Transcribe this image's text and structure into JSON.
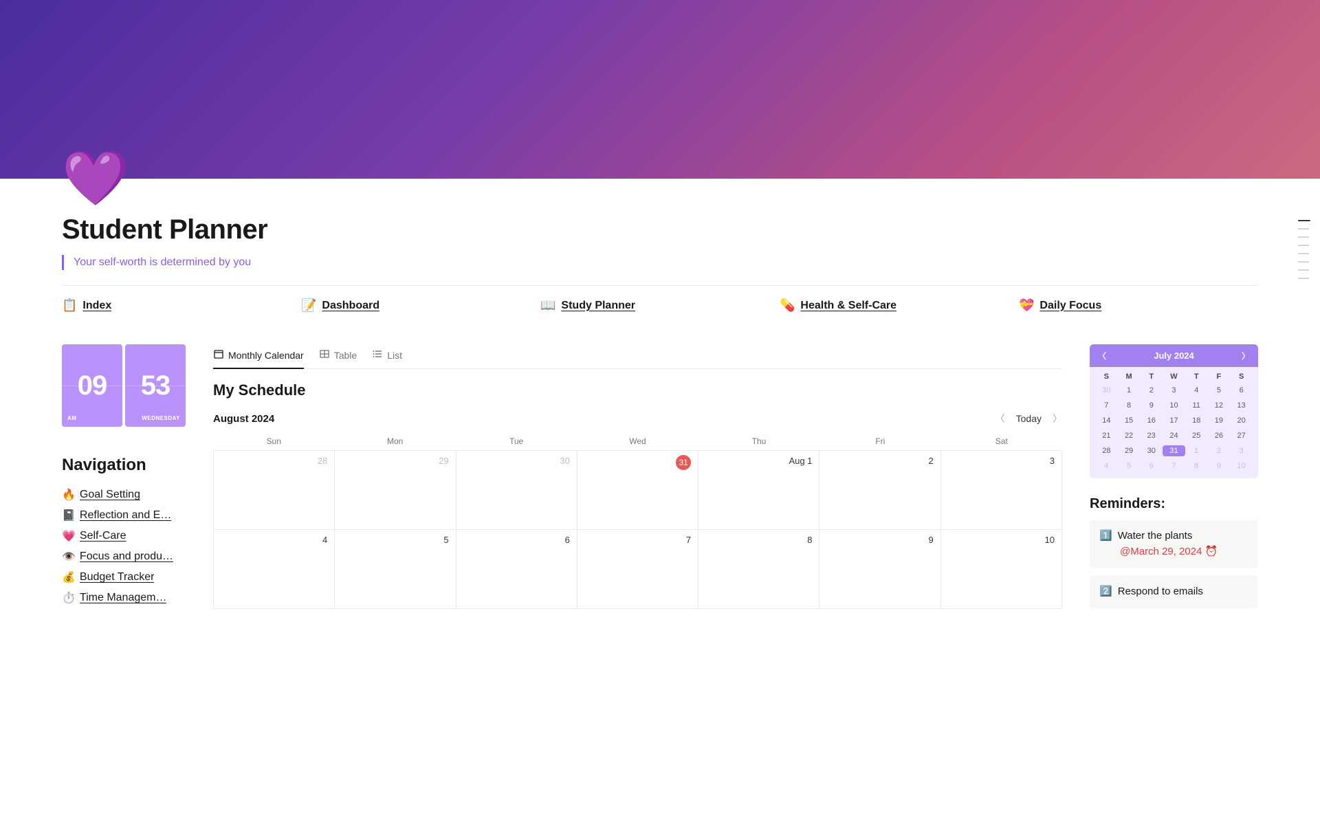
{
  "page": {
    "icon": "💜",
    "title": "Student Planner",
    "quote": "Your self-worth is determined by you"
  },
  "topNav": [
    {
      "emoji": "📋",
      "label": "Index"
    },
    {
      "emoji": "📝",
      "label": "Dashboard"
    },
    {
      "emoji": "📖",
      "label": "Study Planner"
    },
    {
      "emoji": "💊",
      "label": "Health & Self-Care"
    },
    {
      "emoji": "💝",
      "label": "Daily Focus"
    }
  ],
  "clock": {
    "hour": "09",
    "minute": "53",
    "ampm": "AM",
    "day": "WEDNESDAY"
  },
  "navigation": {
    "heading": "Navigation",
    "items": [
      {
        "emoji": "🔥",
        "label": "Goal Setting"
      },
      {
        "emoji": "📓",
        "label": "Reflection and E…"
      },
      {
        "emoji": "💗",
        "label": "Self-Care"
      },
      {
        "emoji": "👁️",
        "label": "Focus and produ…"
      },
      {
        "emoji": "💰",
        "label": "Budget Tracker"
      },
      {
        "emoji": "⏱️",
        "label": "Time Managem…"
      }
    ]
  },
  "views": {
    "tabs": [
      {
        "label": "Monthly Calendar",
        "active": true
      },
      {
        "label": "Table",
        "active": false
      },
      {
        "label": "List",
        "active": false
      }
    ]
  },
  "schedule": {
    "title": "My Schedule",
    "monthLabel": "August 2024",
    "todayLabel": "Today",
    "dow": [
      "Sun",
      "Mon",
      "Tue",
      "Wed",
      "Thu",
      "Fri",
      "Sat"
    ],
    "rows": [
      [
        {
          "text": "28",
          "other": true
        },
        {
          "text": "29",
          "other": true
        },
        {
          "text": "30",
          "other": true
        },
        {
          "text": "31",
          "other": true,
          "today": true
        },
        {
          "text": "Aug 1"
        },
        {
          "text": "2"
        },
        {
          "text": "3"
        }
      ],
      [
        {
          "text": "4"
        },
        {
          "text": "5"
        },
        {
          "text": "6"
        },
        {
          "text": "7"
        },
        {
          "text": "8"
        },
        {
          "text": "9"
        },
        {
          "text": "10"
        }
      ]
    ]
  },
  "miniCal": {
    "title": "July 2024",
    "dow": [
      "S",
      "M",
      "T",
      "W",
      "T",
      "F",
      "S"
    ],
    "days": [
      {
        "n": "30",
        "other": true
      },
      {
        "n": "1"
      },
      {
        "n": "2"
      },
      {
        "n": "3"
      },
      {
        "n": "4"
      },
      {
        "n": "5"
      },
      {
        "n": "6"
      },
      {
        "n": "7"
      },
      {
        "n": "8"
      },
      {
        "n": "9"
      },
      {
        "n": "10"
      },
      {
        "n": "11"
      },
      {
        "n": "12"
      },
      {
        "n": "13"
      },
      {
        "n": "14"
      },
      {
        "n": "15"
      },
      {
        "n": "16"
      },
      {
        "n": "17"
      },
      {
        "n": "18"
      },
      {
        "n": "19"
      },
      {
        "n": "20"
      },
      {
        "n": "21"
      },
      {
        "n": "22"
      },
      {
        "n": "23"
      },
      {
        "n": "24"
      },
      {
        "n": "25"
      },
      {
        "n": "26"
      },
      {
        "n": "27"
      },
      {
        "n": "28"
      },
      {
        "n": "29"
      },
      {
        "n": "30"
      },
      {
        "n": "31",
        "sel": true
      },
      {
        "n": "1",
        "other": true
      },
      {
        "n": "2",
        "other": true
      },
      {
        "n": "3",
        "other": true
      },
      {
        "n": "4",
        "other": true
      },
      {
        "n": "5",
        "other": true
      },
      {
        "n": "6",
        "other": true
      },
      {
        "n": "7",
        "other": true
      },
      {
        "n": "8",
        "other": true
      },
      {
        "n": "9",
        "other": true
      },
      {
        "n": "10",
        "other": true
      }
    ]
  },
  "reminders": {
    "heading": "Reminders:",
    "items": [
      {
        "icon": "1️⃣",
        "text": "Water the plants",
        "date": "@March 29, 2024 ⏰"
      },
      {
        "icon": "2️⃣",
        "text": "Respond to emails",
        "date": ""
      }
    ]
  }
}
